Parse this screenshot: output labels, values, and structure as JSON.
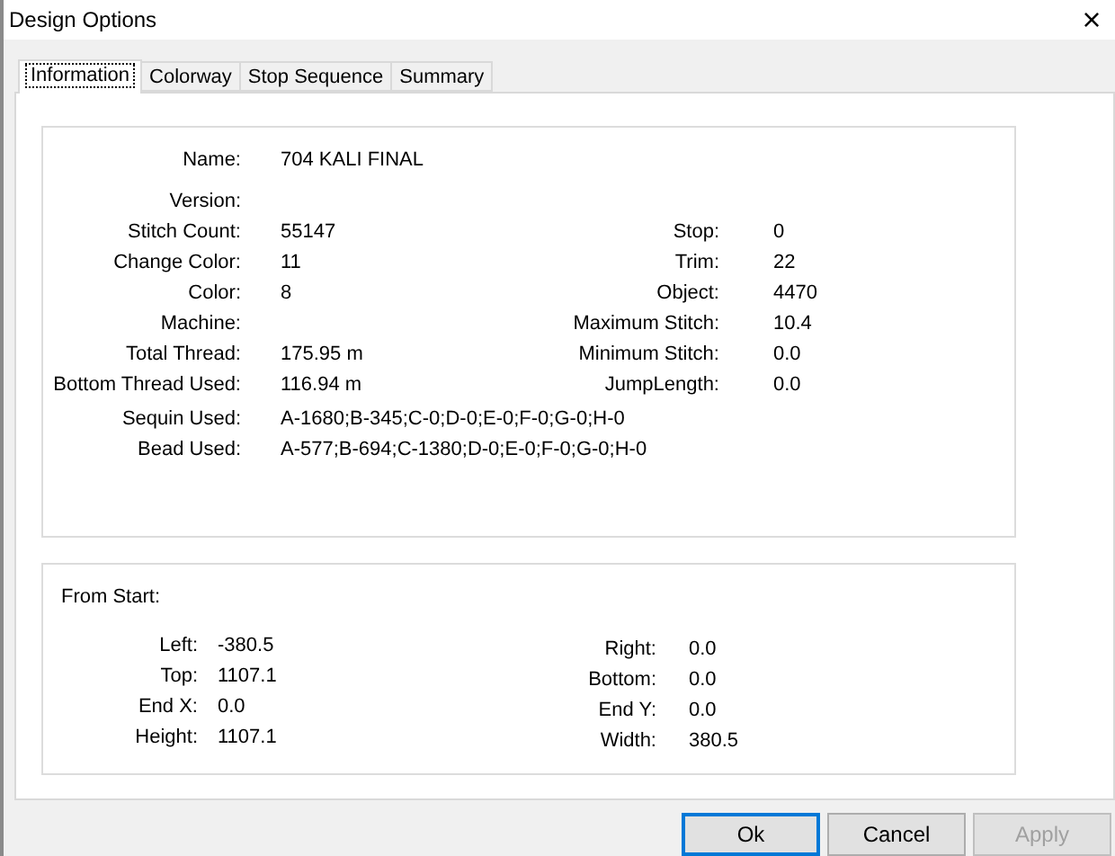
{
  "window": {
    "title": "Design Options",
    "close": "×"
  },
  "tabs": [
    {
      "label": "Information",
      "selected": true
    },
    {
      "label": "Colorway",
      "selected": false
    },
    {
      "label": "Stop Sequence",
      "selected": false
    },
    {
      "label": "Summary",
      "selected": false
    }
  ],
  "info_rows": [
    {
      "left": {
        "label": "Name:",
        "value": "704 KALI FINAL"
      }
    },
    {
      "left": {
        "label": "Version:"
      }
    },
    {
      "left": {
        "label": "Stitch Count:",
        "value": "55147"
      },
      "right": {
        "label": "Stop:",
        "value": "0"
      }
    },
    {
      "left": {
        "label": "Change Color:",
        "value": "11"
      },
      "right": {
        "label": "Trim:",
        "value": "22"
      }
    },
    {
      "left": {
        "label": "Color:",
        "value": "8"
      },
      "right": {
        "label": "Object:",
        "value": "4470"
      }
    },
    {
      "left": {
        "label": "Machine:"
      },
      "right": {
        "label": "Maximum Stitch:",
        "value": "10.4"
      }
    },
    {
      "left": {
        "label": "Total Thread:",
        "value": "175.95 m"
      },
      "right": {
        "label": "Minimum Stitch:",
        "value": "0.0"
      }
    },
    {
      "left": {
        "label": "Bottom Thread Used:",
        "value": "116.94 m"
      },
      "right": {
        "label": "JumpLength:",
        "value": "0.0"
      }
    },
    {
      "left": {
        "label": "Sequin Used:",
        "value": "A-1680;B-345;C-0;D-0;E-0;F-0;G-0;H-0"
      }
    },
    {
      "left": {
        "label": "Bead Used:",
        "value": "A-577;B-694;C-1380;D-0;E-0;F-0;G-0;H-0"
      }
    }
  ],
  "from_start": {
    "title": "From Start:",
    "left": [
      {
        "label": "Left:",
        "value": "-380.5"
      },
      {
        "label": "Top:",
        "value": "1107.1"
      },
      {
        "label": "End X:",
        "value": "0.0"
      },
      {
        "label": "Height:",
        "value": "1107.1"
      }
    ],
    "right": [
      {
        "label": "Right:",
        "value": "0.0"
      },
      {
        "label": "Bottom:",
        "value": "0.0"
      },
      {
        "label": "End Y:",
        "value": "0.0"
      },
      {
        "label": "Width:",
        "value": "380.5"
      }
    ]
  },
  "buttons": [
    {
      "label": "Ok",
      "default": true,
      "disabled": false
    },
    {
      "label": "Cancel",
      "default": false,
      "disabled": false
    },
    {
      "label": "Apply",
      "default": false,
      "disabled": true
    }
  ]
}
